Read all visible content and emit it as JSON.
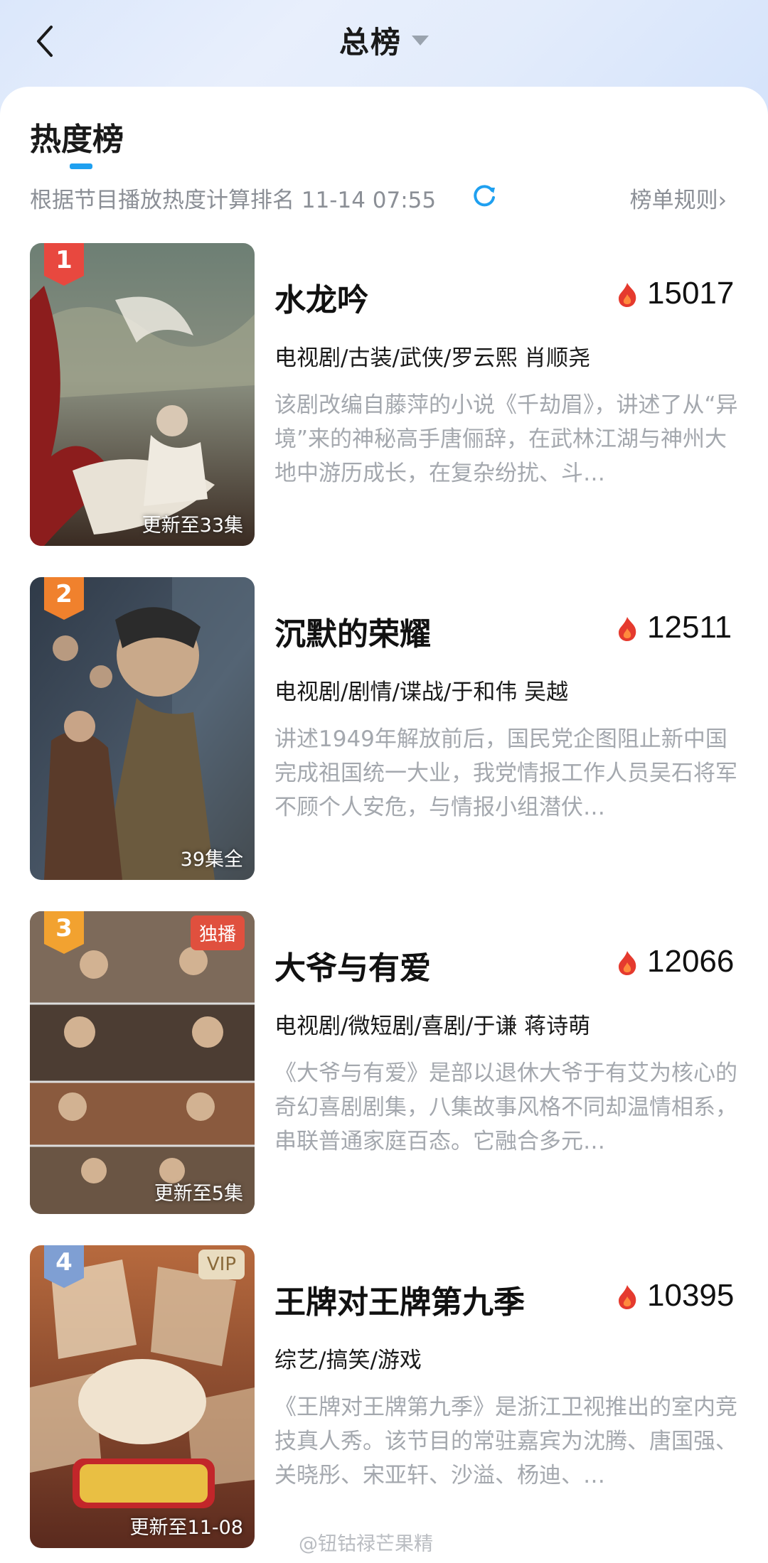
{
  "header": {
    "title": "总榜"
  },
  "section": {
    "title": "热度榜",
    "subtitle": "根据节目播放热度计算排名 11-14 07:55",
    "rules_link": "榜单规则›"
  },
  "items": [
    {
      "rank": "1",
      "title": "水龙吟",
      "heat": "15017",
      "tags": "电视剧/古装/武侠/罗云熙 肖顺尧",
      "description": "该剧改编自藤萍的小说《千劫眉》，讲述了从“异境”来的神秘高手唐俪辞，在武林江湖与神州大地中游历成长，在复杂纷扰、斗…",
      "episode": "更新至33集",
      "corner_tag": "",
      "badge_color": "#e8483f"
    },
    {
      "rank": "2",
      "title": "沉默的荣耀",
      "heat": "12511",
      "tags": "电视剧/剧情/谍战/于和伟 吴越",
      "description": "讲述1949年解放前后，国民党企图阻止新中国完成祖国统一大业，我党情报工作人员吴石将军不顾个人安危，与情报小组潜伏…",
      "episode": "39集全",
      "corner_tag": "",
      "badge_color": "#f0812d"
    },
    {
      "rank": "3",
      "title": "大爷与有爱",
      "heat": "12066",
      "tags": "电视剧/微短剧/喜剧/于谦 蒋诗萌",
      "description": "《大爷与有爱》是部以退休大爷于有艾为核心的奇幻喜剧剧集，八集故事风格不同却温情相系，串联普通家庭百态。它融合多元…",
      "episode": "更新至5集",
      "corner_tag": "独播",
      "badge_color": "#f2a230"
    },
    {
      "rank": "4",
      "title": "王牌对王牌第九季",
      "heat": "10395",
      "tags": "综艺/搞笑/游戏",
      "description": "《王牌对王牌第九季》是浙江卫视推出的室内竞技真人秀。该节目的常驻嘉宾为沈腾、唐国强、关晓彤、宋亚轩、沙溢、杨迪、…",
      "episode": "更新至11-08",
      "corner_tag": "VIP",
      "badge_color": "#7f9fd3"
    }
  ],
  "watermark": "@钮钴禄芒果精"
}
